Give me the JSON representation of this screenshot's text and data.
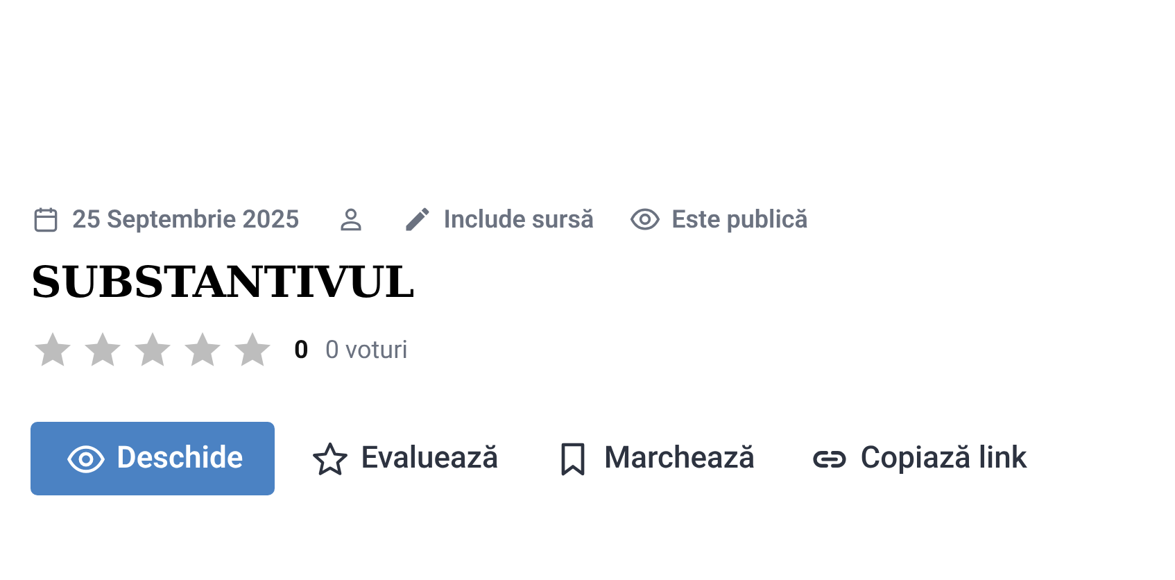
{
  "meta": [
    {
      "kind": "calendar",
      "text": "25 Septembrie 2025"
    },
    {
      "kind": "user"
    },
    {
      "kind": "pencil",
      "text": "Include sursă"
    },
    {
      "kind": "eye",
      "text": "Este publică"
    }
  ],
  "title": "SUBSTANTIVUL",
  "rating": {
    "stars": 0,
    "score": "0",
    "votes": "0 voturi"
  },
  "actions": [
    {
      "kind": "open",
      "label": "Deschide"
    },
    {
      "kind": "rate",
      "label": "Evaluează"
    },
    {
      "kind": "bookmark",
      "label": "Marchează"
    },
    {
      "kind": "copy",
      "label": "Copiază link"
    }
  ]
}
